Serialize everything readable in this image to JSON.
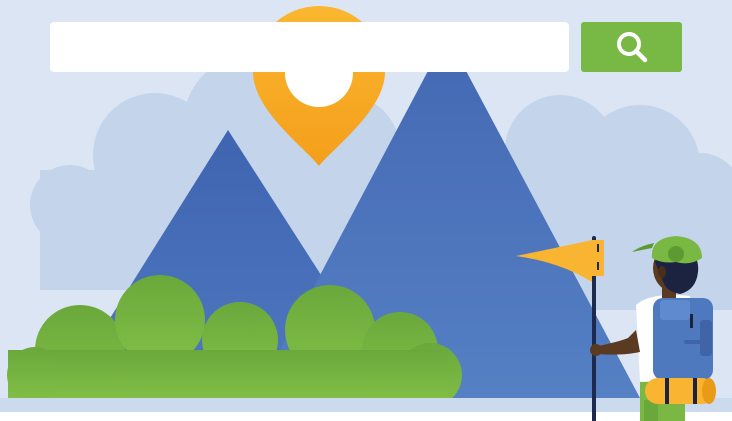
{
  "search": {
    "value": "",
    "placeholder": ""
  },
  "colors": {
    "background": "#dbe5f3",
    "clouds": "#c4d4ea",
    "mountain": "#4a72bb",
    "bush": "#7ab843",
    "search_button": "#78b844",
    "pin": "#f8a81c",
    "flag": "#f9b532",
    "backpack": "#4f79bf"
  },
  "icons": {
    "search_button": "search-icon",
    "pin": "location-pin-icon"
  }
}
